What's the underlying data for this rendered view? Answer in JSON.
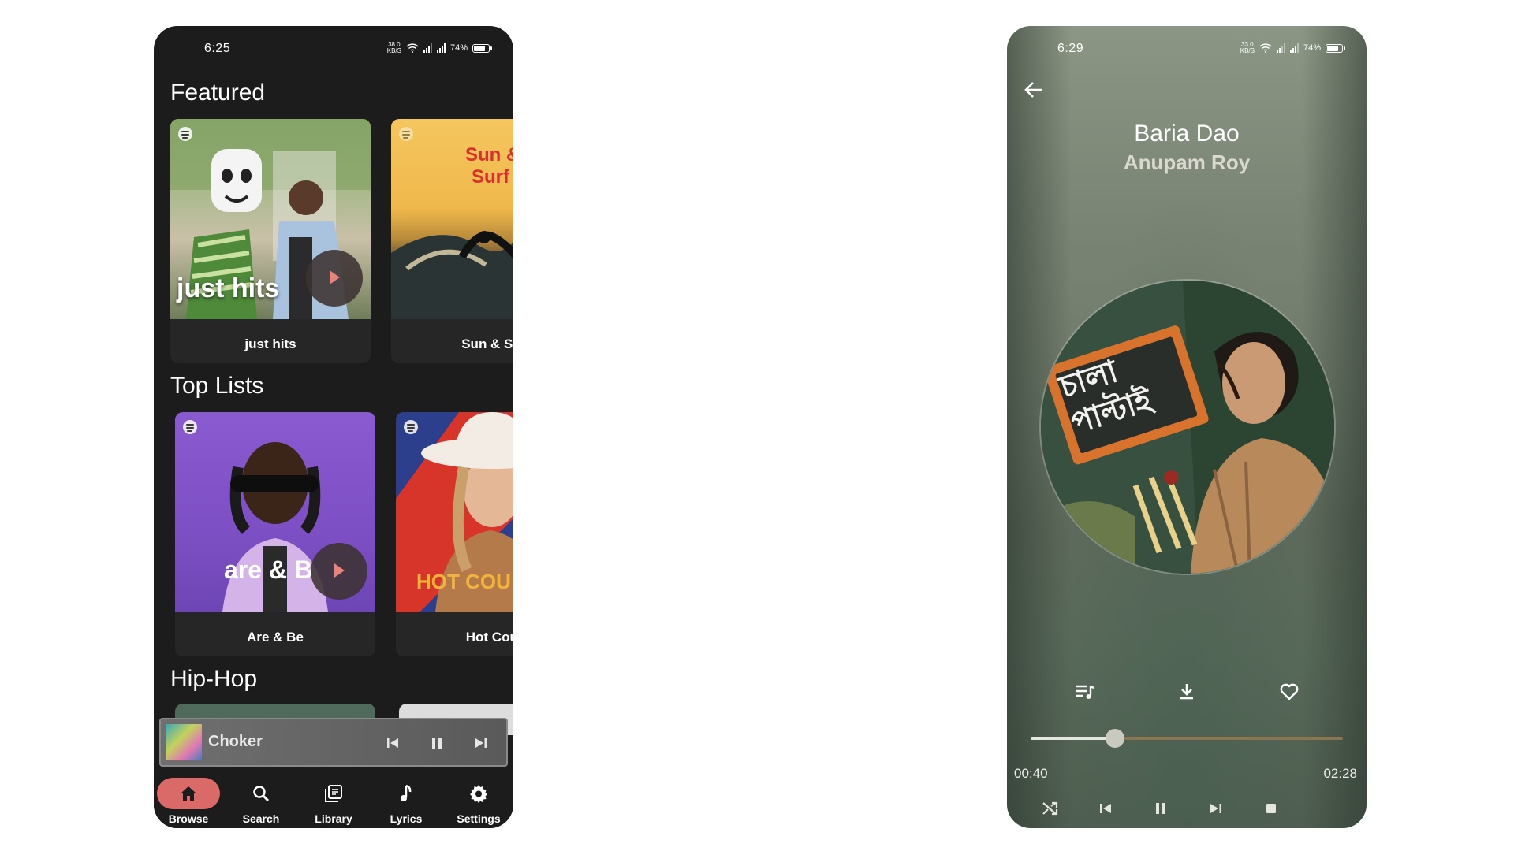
{
  "left_screen": {
    "status": {
      "time": "6:25",
      "net_speed": "38.0",
      "net_unit": "KB/S",
      "battery": "74%"
    },
    "sections": [
      {
        "title": "Featured",
        "cards": [
          {
            "label": "just hits",
            "art_text": "just hits"
          },
          {
            "label": "Sun & Su",
            "art_text": [
              "Sun &",
              "Surf"
            ]
          }
        ]
      },
      {
        "title": "Top Lists",
        "cards": [
          {
            "label": "Are & Be",
            "art_text": "are & B"
          },
          {
            "label": "Hot Coun",
            "art_text": "HOT COU"
          }
        ]
      },
      {
        "title": "Hip-Hop"
      }
    ],
    "mini_player": {
      "title": "Choker"
    },
    "nav": [
      {
        "label": "Browse",
        "icon": "home-icon"
      },
      {
        "label": "Search",
        "icon": "search-icon"
      },
      {
        "label": "Library",
        "icon": "library-icon"
      },
      {
        "label": "Lyrics",
        "icon": "music-note-icon"
      },
      {
        "label": "Settings",
        "icon": "gear-icon"
      }
    ],
    "colors": {
      "background": "#1c1c1c",
      "accent": "#d96a67",
      "card": "#262626"
    }
  },
  "right_screen": {
    "status": {
      "time": "6:29",
      "net_speed": "33.0",
      "net_unit": "KB/S",
      "battery": "74%"
    },
    "song": {
      "title": "Baria Dao",
      "artist": "Anupam Roy"
    },
    "album_art_text": [
      "চালা",
      "পাল্টাই"
    ],
    "progress": {
      "elapsed": "00:40",
      "total": "02:28",
      "fraction": 0.27
    },
    "actions": [
      "queue-icon",
      "download-icon",
      "heart-icon"
    ],
    "controls": [
      "shuffle-icon",
      "previous-icon",
      "pause-icon",
      "next-icon",
      "stop-icon"
    ]
  }
}
